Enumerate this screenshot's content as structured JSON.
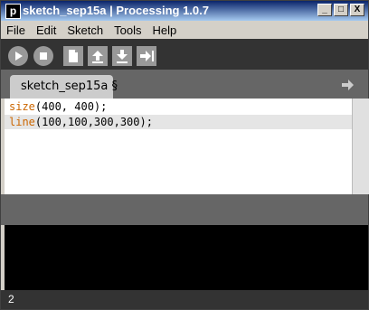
{
  "window": {
    "title": "sketch_sep15a | Processing 1.0.7",
    "app_icon_letter": "p"
  },
  "titlebar_buttons": [
    "_",
    "□",
    "X"
  ],
  "menu": [
    "File",
    "Edit",
    "Sketch",
    "Tools",
    "Help"
  ],
  "toolbar": {
    "icons": [
      "run-icon",
      "stop-icon",
      "new-icon",
      "open-icon",
      "save-icon",
      "export-icon"
    ]
  },
  "tabs": [
    {
      "label": "sketch_sep15a",
      "marker": "§"
    }
  ],
  "code": {
    "lines": [
      {
        "keyword": "size",
        "args": "(400, 400);"
      },
      {
        "keyword": "line",
        "args": "(100,100,300,300);"
      }
    ]
  },
  "status": {
    "line_number": "2"
  },
  "colors": {
    "toolbar_bg": "#333333",
    "tab_area_bg": "#666666",
    "keyword": "#cc6600",
    "console_bg": "#000000"
  }
}
